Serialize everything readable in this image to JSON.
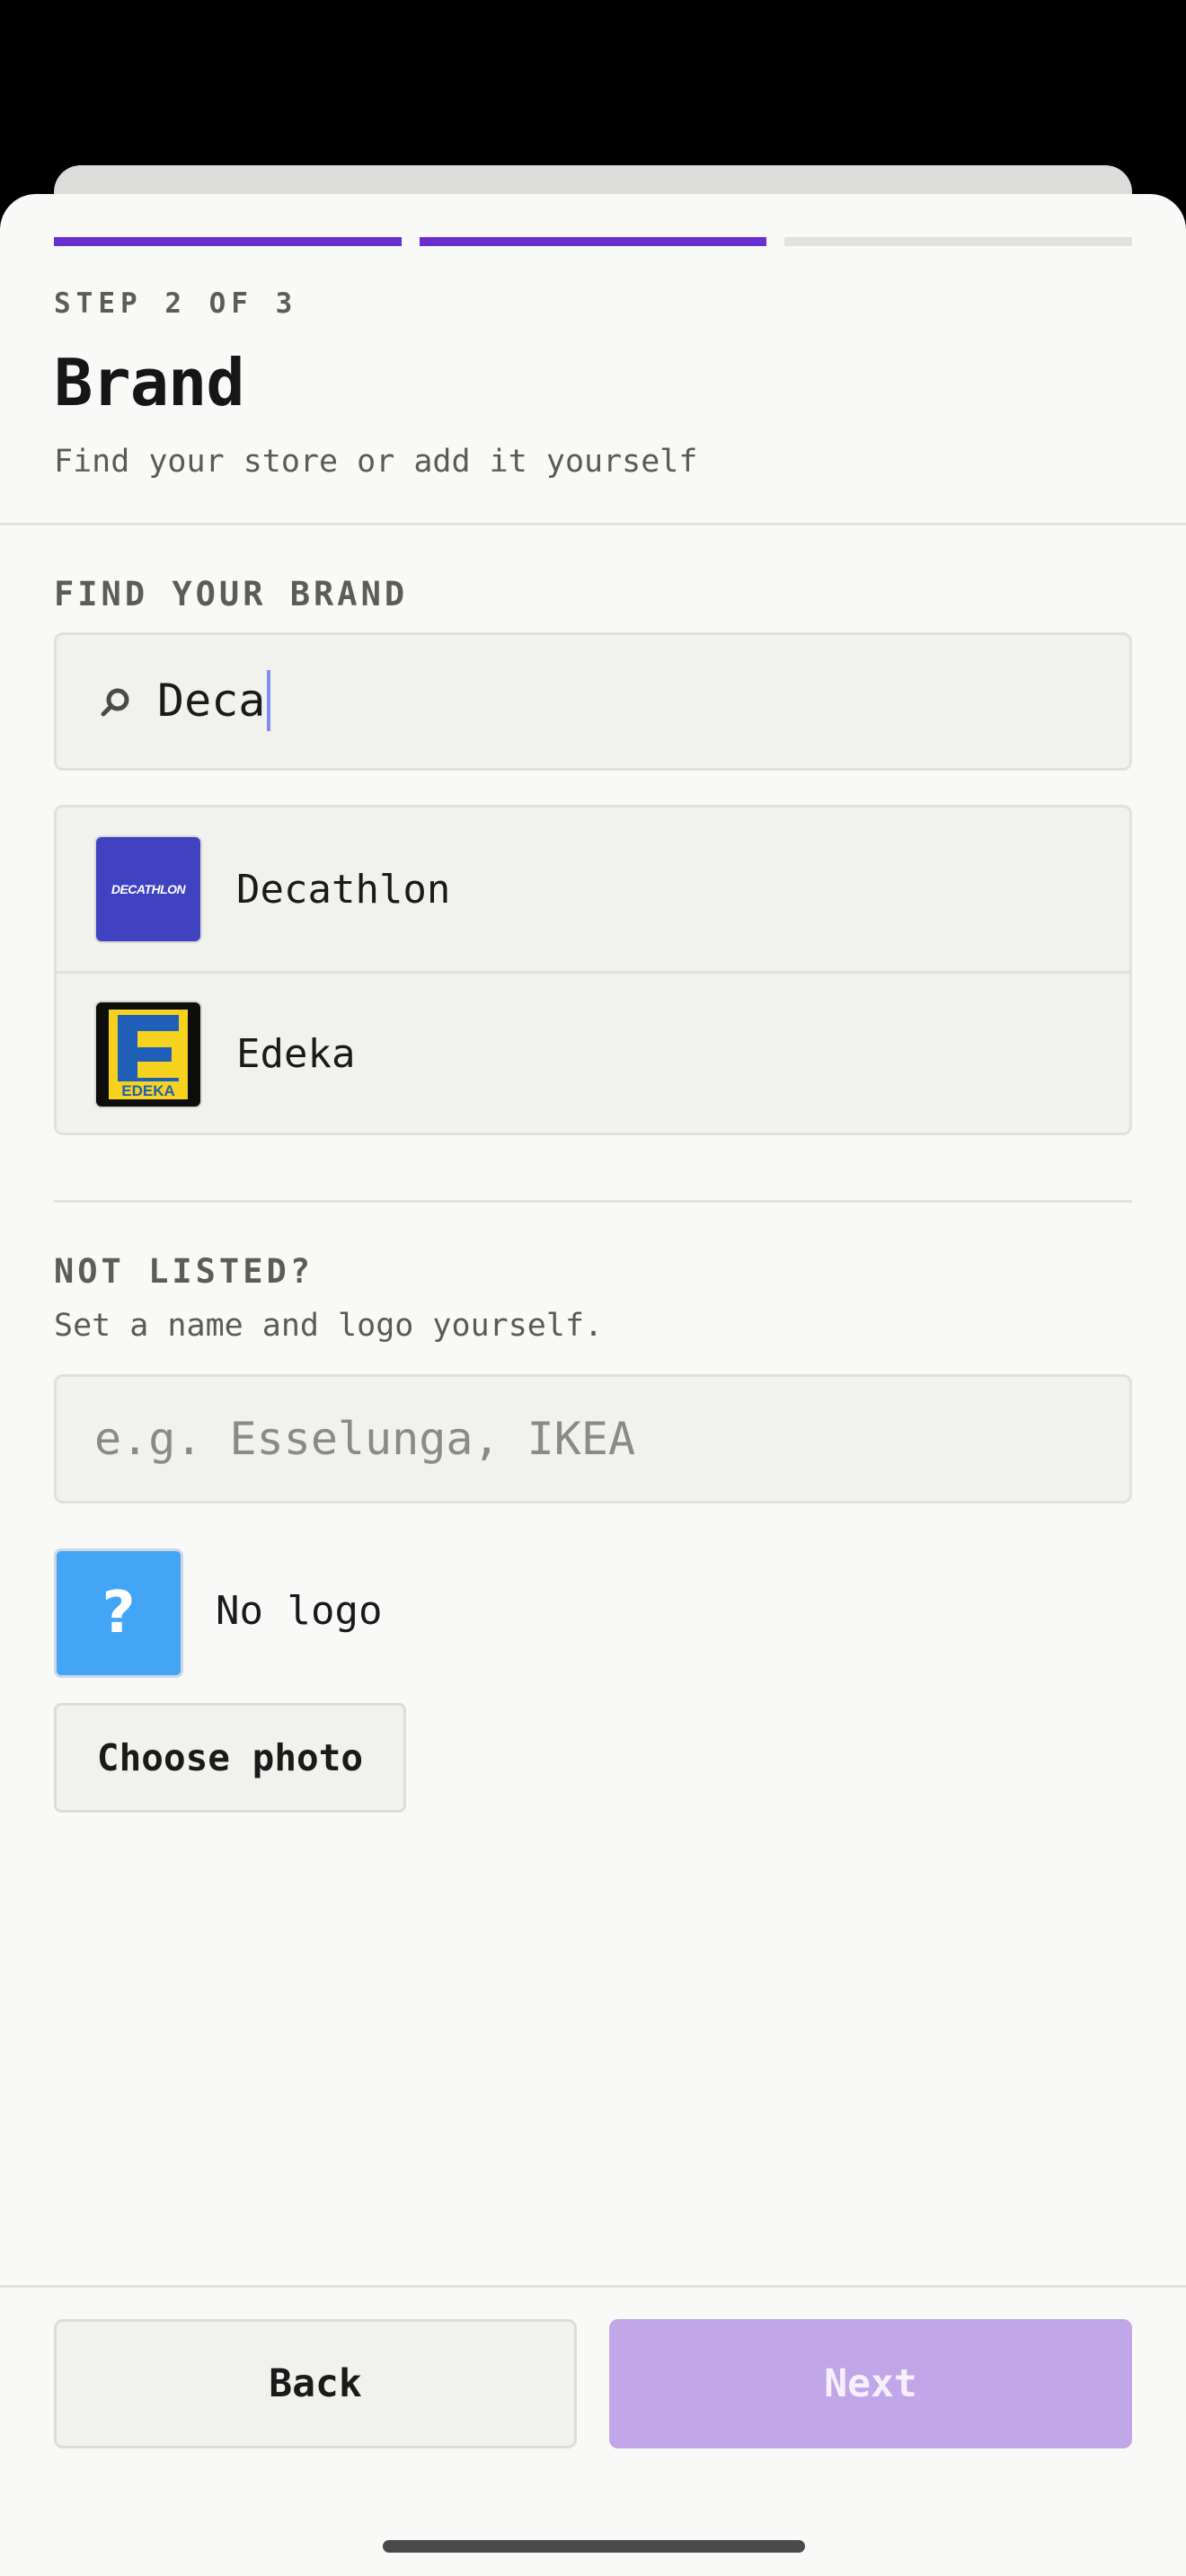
{
  "progress": {
    "current_step": 2,
    "total_steps": 3
  },
  "header": {
    "step_label": "STEP 2 OF 3",
    "title": "Brand",
    "subtitle": "Find your store or add it yourself"
  },
  "find_brand": {
    "label": "FIND YOUR BRAND",
    "search_icon": "search-icon",
    "search_value": "Deca",
    "results": [
      {
        "name": "Decathlon",
        "logo_text": "DECATHLON",
        "logo_color": "#3f43c1"
      },
      {
        "name": "Edeka",
        "logo_text": "EDEKA",
        "logo_color": "#f6d21f"
      }
    ]
  },
  "not_listed": {
    "label": "NOT LISTED?",
    "description": "Set a name and logo yourself.",
    "name_placeholder": "e.g. Esselunga, IKEA",
    "logo_placeholder_glyph": "?",
    "logo_status": "No logo",
    "choose_photo_label": "Choose photo"
  },
  "footer": {
    "back_label": "Back",
    "next_label": "Next"
  },
  "colors": {
    "accent": "#6b2ed1",
    "next_disabled": "#c1a6e8",
    "logo_placeholder": "#42a5f5"
  }
}
